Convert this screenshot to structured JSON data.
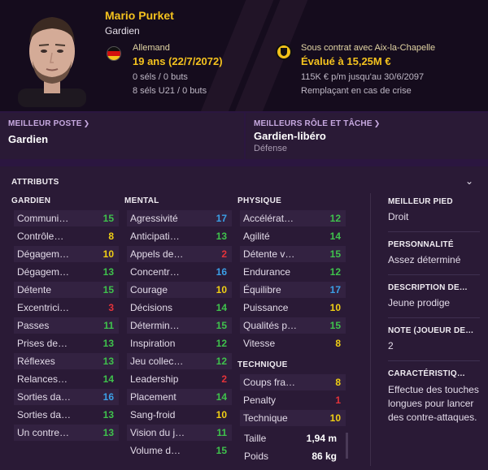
{
  "player": {
    "name": "Mario Purket",
    "position": "Gardien",
    "nationality": "Allemand",
    "age": "19 ans (22/7/2072)",
    "caps": "0 séls / 0 buts",
    "u21_caps": "8 séls U21 / 0 buts",
    "contract": "Sous contrat avec Aix-la-Chapelle",
    "value": "Évalué à 15,25M €",
    "wage": "115K € p/m jusqu'au 30/6/2097",
    "status": "Remplaçant en cas de crise"
  },
  "best_position": {
    "title": "MEILLEUR POSTE",
    "value": "Gardien"
  },
  "best_role": {
    "title": "MEILLEURS RÔLE ET TÂCHE",
    "value": "Gardien-libéro",
    "sub": "Défense"
  },
  "attributes": {
    "title": "ATTRIBUTS",
    "columns": [
      {
        "heading": "GARDIEN",
        "rows": [
          {
            "label": "Communi…",
            "value": "15",
            "color": "#3fc24c"
          },
          {
            "label": "Contrôle…",
            "value": "8",
            "color": "#f0cf14"
          },
          {
            "label": "Dégagem…",
            "value": "10",
            "color": "#f0cf14"
          },
          {
            "label": "Dégagem…",
            "value": "13",
            "color": "#3fc24c"
          },
          {
            "label": "Détente",
            "value": "15",
            "color": "#3fc24c"
          },
          {
            "label": "Excentrici…",
            "value": "3",
            "color": "#e4333a"
          },
          {
            "label": "Passes",
            "value": "11",
            "color": "#3fc24c"
          },
          {
            "label": "Prises de…",
            "value": "13",
            "color": "#3fc24c"
          },
          {
            "label": "Réflexes",
            "value": "13",
            "color": "#3fc24c"
          },
          {
            "label": "Relances…",
            "value": "14",
            "color": "#3fc24c"
          },
          {
            "label": "Sorties da…",
            "value": "16",
            "color": "#3b9fe6"
          },
          {
            "label": "Sorties da…",
            "value": "13",
            "color": "#3fc24c"
          },
          {
            "label": "Un contre…",
            "value": "13",
            "color": "#3fc24c"
          }
        ]
      },
      {
        "heading": "MENTAL",
        "rows": [
          {
            "label": "Agressivité",
            "value": "17",
            "color": "#3b9fe6"
          },
          {
            "label": "Anticipati…",
            "value": "13",
            "color": "#3fc24c"
          },
          {
            "label": "Appels de…",
            "value": "2",
            "color": "#e4333a"
          },
          {
            "label": "Concentr…",
            "value": "16",
            "color": "#3b9fe6"
          },
          {
            "label": "Courage",
            "value": "10",
            "color": "#f0cf14"
          },
          {
            "label": "Décisions",
            "value": "14",
            "color": "#3fc24c"
          },
          {
            "label": "Détermin…",
            "value": "15",
            "color": "#3fc24c"
          },
          {
            "label": "Inspiration",
            "value": "12",
            "color": "#3fc24c"
          },
          {
            "label": "Jeu collec…",
            "value": "12",
            "color": "#3fc24c"
          },
          {
            "label": "Leadership",
            "value": "2",
            "color": "#e4333a"
          },
          {
            "label": "Placement",
            "value": "14",
            "color": "#3fc24c"
          },
          {
            "label": "Sang-froid",
            "value": "10",
            "color": "#f0cf14"
          },
          {
            "label": "Vision du j…",
            "value": "11",
            "color": "#3fc24c"
          },
          {
            "label": "Volume d…",
            "value": "15",
            "color": "#3fc24c"
          }
        ]
      },
      {
        "heading": "PHYSIQUE",
        "rows": [
          {
            "label": "Accélérat…",
            "value": "12",
            "color": "#3fc24c"
          },
          {
            "label": "Agilité",
            "value": "14",
            "color": "#3fc24c"
          },
          {
            "label": "Détente v…",
            "value": "15",
            "color": "#3fc24c"
          },
          {
            "label": "Endurance",
            "value": "12",
            "color": "#3fc24c"
          },
          {
            "label": "Équilibre",
            "value": "17",
            "color": "#3b9fe6"
          },
          {
            "label": "Puissance",
            "value": "10",
            "color": "#f0cf14"
          },
          {
            "label": "Qualités p…",
            "value": "15",
            "color": "#3fc24c"
          },
          {
            "label": "Vitesse",
            "value": "8",
            "color": "#f0cf14"
          }
        ]
      },
      {
        "heading": "TECHNIQUE",
        "rows": [
          {
            "label": "Coups fra…",
            "value": "8",
            "color": "#f0cf14"
          },
          {
            "label": "Penalty",
            "value": "1",
            "color": "#e4333a"
          },
          {
            "label": "Technique",
            "value": "10",
            "color": "#f0cf14"
          }
        ]
      }
    ],
    "height_label": "Taille",
    "height": "1,94 m",
    "weight_label": "Poids",
    "weight": "86 kg"
  },
  "info": {
    "foot_title": "MEILLEUR PIED",
    "foot": "Droit",
    "personality_title": "PERSONNALITÉ",
    "personality": "Assez déterminé",
    "description_title": "DESCRIPTION DE…",
    "description": "Jeune prodige",
    "rating_title": "NOTE (JOUEUR DE…",
    "rating": "2",
    "traits_title": "CARACTÉRISTIQ…",
    "traits": "Effectue des touches longues pour lancer des contre-attaques."
  }
}
